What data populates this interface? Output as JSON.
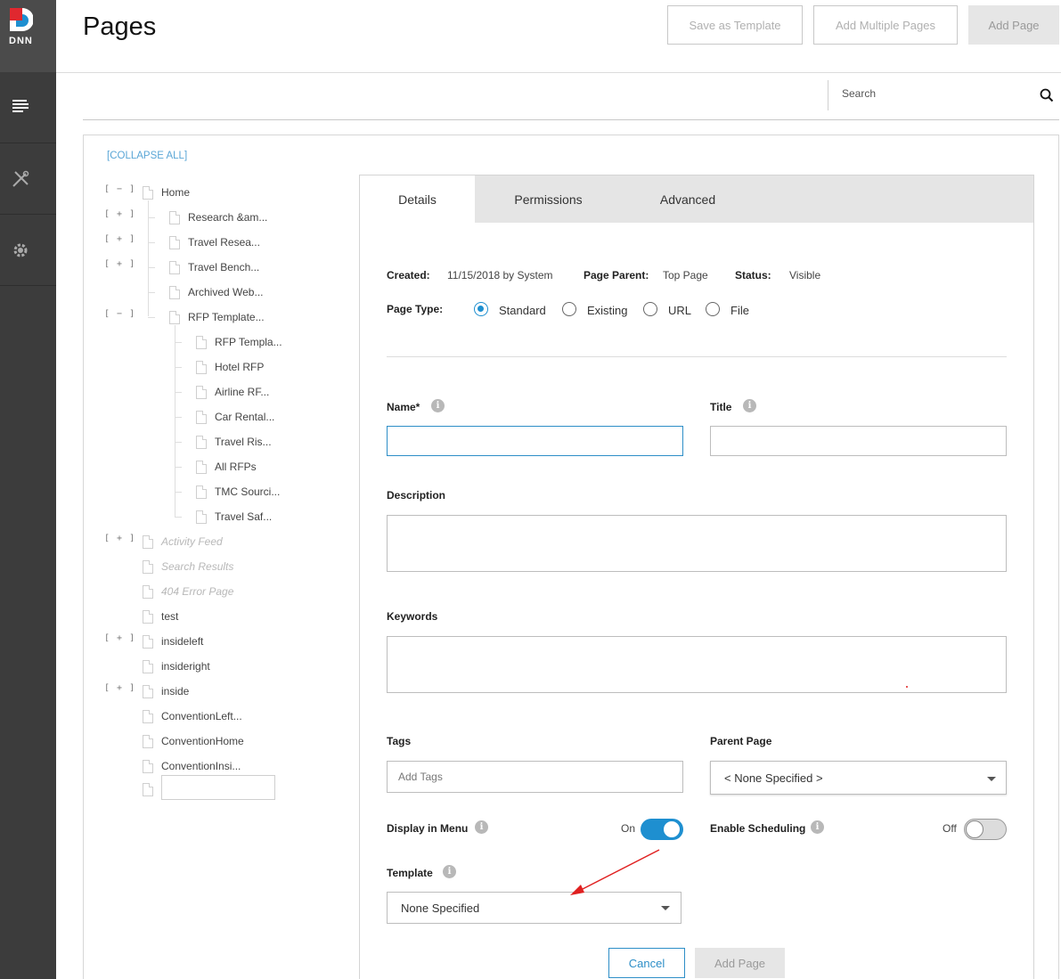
{
  "app": {
    "logo_text": "DNN",
    "page_title": "Pages"
  },
  "header": {
    "save_template": "Save as Template",
    "add_multiple": "Add Multiple Pages",
    "add_page": "Add Page"
  },
  "rail": {
    "items": [
      "pages-icon",
      "tools-icon",
      "settings-icon"
    ]
  },
  "search": {
    "placeholder": "Search"
  },
  "tree": {
    "collapse_all": "[COLLAPSE ALL]",
    "items": [
      "Home",
      "Research &am...",
      "Travel Resea...",
      "Travel Bench...",
      "Archived Web...",
      "RFP Template...",
      "RFP Templa...",
      "Hotel RFP",
      "Airline RF...",
      "Car Rental...",
      "Travel Ris...",
      "All RFPs",
      "TMC Sourci...",
      "Travel Saf...",
      "Activity Feed",
      "Search Results",
      "404 Error Page",
      "test",
      "insideleft",
      "insideright",
      "inside",
      "ConventionLeft...",
      "ConventionHome",
      "ConventionInsi..."
    ],
    "toggles": {
      "collapse": "[ − ]",
      "expand": "[ + ]"
    }
  },
  "tabs": {
    "details": "Details",
    "permissions": "Permissions",
    "advanced": "Advanced"
  },
  "meta": {
    "created_label": "Created:",
    "created_value": "11/15/2018 by System",
    "parent_label": "Page Parent:",
    "parent_value": "Top Page",
    "status_label": "Status:",
    "status_value": "Visible",
    "page_type_label": "Page Type:",
    "page_types": [
      "Standard",
      "Existing",
      "URL",
      "File"
    ],
    "page_type_selected": "Standard"
  },
  "form": {
    "name_label": "Name*",
    "title_label": "Title",
    "description_label": "Description",
    "keywords_label": "Keywords",
    "tags_label": "Tags",
    "tags_placeholder": "Add Tags",
    "parent_page_label": "Parent Page",
    "parent_page_value": "< None Specified >",
    "display_menu_label": "Display in Menu",
    "display_menu_state": "On",
    "scheduling_label": "Enable Scheduling",
    "scheduling_state": "Off",
    "template_label": "Template",
    "template_value": "None Specified",
    "info_glyph": "i",
    "cancel": "Cancel",
    "add_page": "Add Page"
  },
  "colors": {
    "accent": "#1e8fd0",
    "rail": "#3c3c3c",
    "annotation_arrow": "#e02020"
  }
}
